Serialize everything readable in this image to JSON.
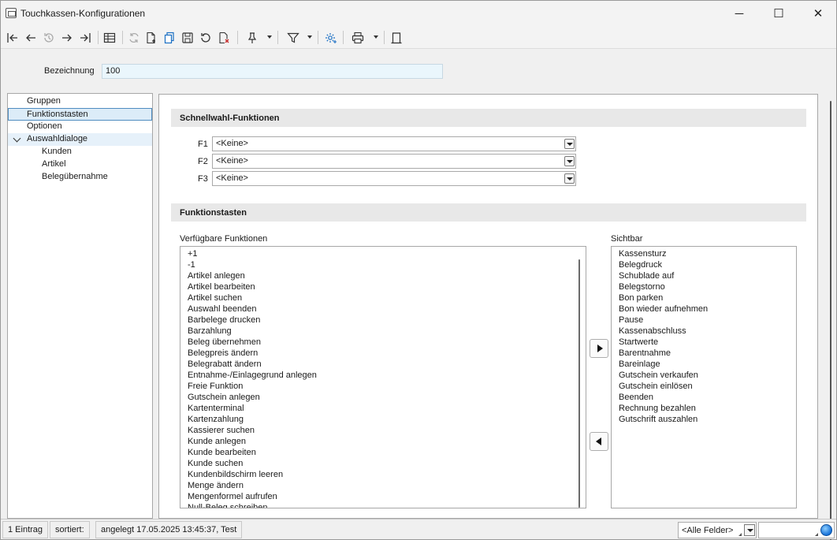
{
  "window": {
    "title": "Touchkassen-Konfigurationen",
    "minimize_glyph": "─",
    "maximize_glyph": "☐",
    "close_glyph": "✕"
  },
  "toolbar": {
    "icons": [
      "first-record-icon",
      "previous-record-icon",
      "history-icon",
      "next-record-icon",
      "last-record-icon",
      "table-view-icon",
      "refresh-icon",
      "new-record-icon",
      "copy-record-icon",
      "save-icon",
      "undo-icon",
      "delete-record-icon",
      "pin-icon",
      "filter-icon",
      "settings-icon",
      "print-icon",
      "exit-icon"
    ]
  },
  "form": {
    "bezeichnung_label": "Bezeichnung",
    "bezeichnung_value": "100"
  },
  "tree": {
    "items": [
      {
        "label": "Gruppen"
      },
      {
        "label": "Funktionstasten"
      },
      {
        "label": "Optionen"
      },
      {
        "label": "Auswahldialoge"
      },
      {
        "label": "Kunden"
      },
      {
        "label": "Artikel"
      },
      {
        "label": "Belegübernahme"
      }
    ]
  },
  "schnellwahl": {
    "title": "Schnellwahl-Funktionen",
    "rows": [
      {
        "key": "F1",
        "value": "<Keine>"
      },
      {
        "key": "F2",
        "value": "<Keine>"
      },
      {
        "key": "F3",
        "value": "<Keine>"
      }
    ]
  },
  "funktionstasten": {
    "title": "Funktionstasten",
    "available_label": "Verfügbare Funktionen",
    "visible_label": "Sichtbar",
    "available": [
      "+1",
      "-1",
      "Artikel anlegen",
      "Artikel bearbeiten",
      "Artikel suchen",
      "Auswahl beenden",
      "Barbelege drucken",
      "Barzahlung",
      "Beleg übernehmen",
      "Belegpreis ändern",
      "Belegrabatt ändern",
      "Entnahme-/Einlagegrund anlegen",
      "Freie Funktion",
      "Gutschein anlegen",
      "Kartenterminal",
      "Kartenzahlung",
      "Kassierer suchen",
      "Kunde anlegen",
      "Kunde bearbeiten",
      "Kunde suchen",
      "Kundenbildschirm leeren",
      "Menge ändern",
      "Mengenformel aufrufen",
      "Null-Beleg schreiben"
    ],
    "visible": [
      "Kassensturz",
      "Belegdruck",
      "Schublade auf",
      "Belegstorno",
      "Bon parken",
      "Bon wieder aufnehmen",
      "Pause",
      "Kassenabschluss",
      "Startwerte",
      "Barentnahme",
      "Bareinlage",
      "Gutschein verkaufen",
      "Gutschein einlösen",
      "Beenden",
      "Rechnung bezahlen",
      "Gutschrift auszahlen"
    ]
  },
  "statusbar": {
    "count": "1 Eintrag",
    "sorted": "sortiert:",
    "created": "angelegt 17.05.2025 13:45:37, Test",
    "filter_value": "<Alle Felder>"
  }
}
